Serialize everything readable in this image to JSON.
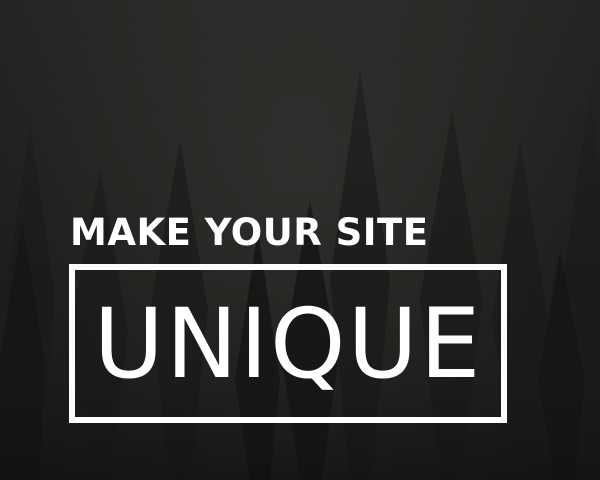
{
  "banner": {
    "headline": "MAKE YOUR SITE",
    "highlight_word": "UNIQUE"
  },
  "colors": {
    "background": "#1c1d1b",
    "text": "#ffffff",
    "frame": "#ffffff"
  }
}
